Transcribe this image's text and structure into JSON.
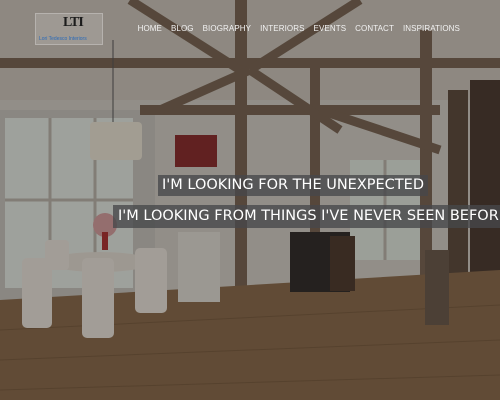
{
  "logo": {
    "mark": "LTI",
    "text": "Lori Tedesco Interiors"
  },
  "nav": {
    "items": [
      "HOME",
      "BLOG",
      "BIOGRAPHY",
      "INTERIORS",
      "EVENTS",
      "CONTACT",
      "INSPIRATIONS"
    ]
  },
  "hero": {
    "line1": "I'M LOOKING FOR THE UNEXPECTED",
    "line2": "I'M LOOKING FROM THINGS I'VE NEVER SEEN BEFORE"
  }
}
